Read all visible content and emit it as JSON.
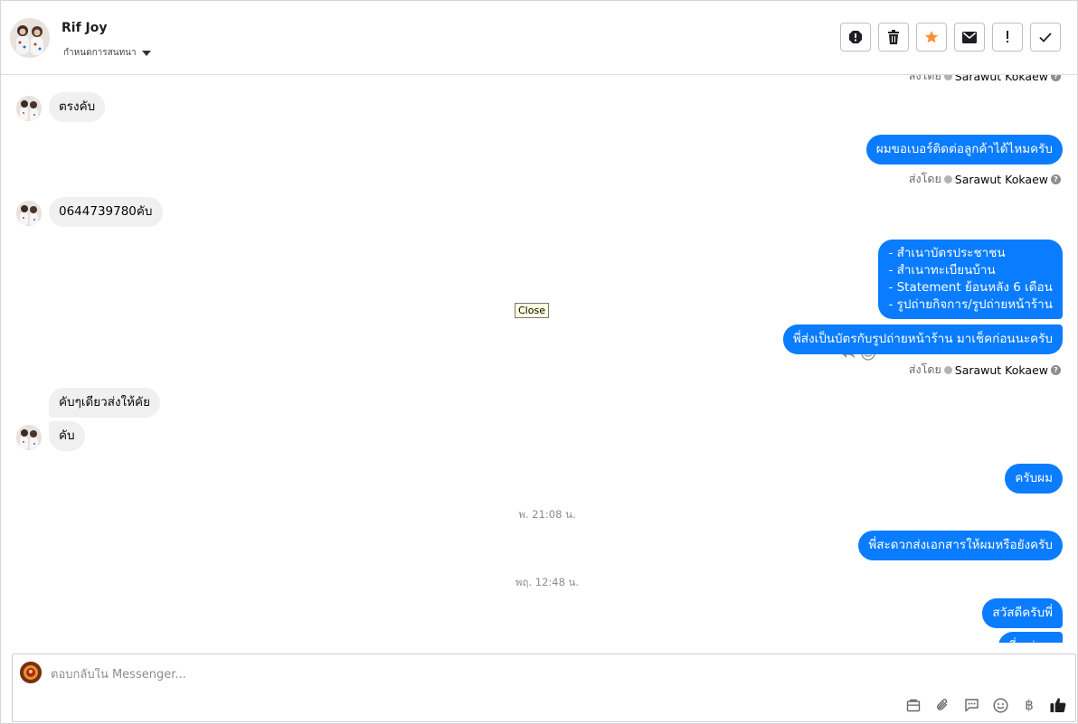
{
  "header": {
    "contact_name": "Rif Joy",
    "assign_label": "กำหนดการสนทนา",
    "actions": [
      "mark-spam",
      "delete",
      "star",
      "mark-unread",
      "follow-up",
      "done"
    ]
  },
  "thread": {
    "cut_top_meta": "ส่งโดย Sarawut Kokaew",
    "messages": [
      {
        "dir": "in",
        "text": "ตรงคับ"
      },
      {
        "dir": "out",
        "text": "ผมขอเบอร์ติดต่อลูกค้าได้ไหมครับ"
      },
      {
        "dir": "in",
        "text": "0644739780คับ"
      },
      {
        "dir": "out",
        "lines": [
          "- สำเนาบัตรประชาชน",
          "- สำเนาทะเบียนบ้าน",
          "- Statement ย้อนหลัง 6 เดือน",
          "- รูปถ่ายกิจการ/รูปถ่ายหน้าร้าน"
        ]
      },
      {
        "dir": "out",
        "text": "พี่ส่งเป็นบัตรกับรูปถ่ายหน้าร้าน มาเช็คก่อนนะครับ"
      },
      {
        "dir": "in",
        "text": "คับๆเดียวส่งให้คัย"
      },
      {
        "dir": "in",
        "text": "คับ"
      },
      {
        "dir": "out",
        "text": "ครับผม"
      },
      {
        "dir": "out",
        "text": "พี่สะดวกส่งเอกสารให้ผมหรือยังครับ"
      },
      {
        "dir": "out",
        "text": "สวัสดีครับพี่"
      },
      {
        "dir": "out",
        "text": "พี่ส.ส่ง..."
      }
    ],
    "sent_by_prefix": "ส่งโดย",
    "sent_by_name": "Sarawut Kokaew",
    "timestamps": [
      "พ. 21:08 น.",
      "พฤ. 12:48 น."
    ],
    "tooltip": "Close"
  },
  "composer": {
    "placeholder": "ตอบกลับใน Messenger...",
    "currency_symbol": "฿"
  },
  "colors": {
    "outgoing": "#0a7cff",
    "incoming": "#f0f0f0",
    "star": "#f7923a"
  }
}
